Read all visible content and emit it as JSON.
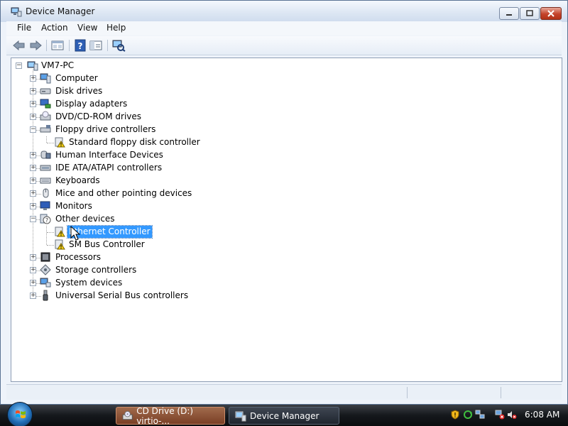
{
  "window": {
    "title": "Device Manager"
  },
  "menu": [
    "File",
    "Action",
    "View",
    "Help"
  ],
  "toolbar": {
    "buttons": [
      "back-arrow-icon",
      "forward-arrow-icon",
      "properties-icon",
      "help-icon",
      "show-hide-icon",
      "scan-hardware-icon"
    ]
  },
  "tree": {
    "root": "VM7-PC",
    "categories": [
      {
        "label": "Computer",
        "icon": "computer-icon",
        "expanded": false
      },
      {
        "label": "Disk drives",
        "icon": "disk-drive-icon",
        "expanded": false
      },
      {
        "label": "Display adapters",
        "icon": "display-adapter-icon",
        "expanded": false
      },
      {
        "label": "DVD/CD-ROM drives",
        "icon": "dvd-drive-icon",
        "expanded": false
      },
      {
        "label": "Floppy drive controllers",
        "icon": "floppy-controller-icon",
        "expanded": true,
        "children": [
          {
            "label": "Standard floppy disk controller",
            "warning": true
          }
        ]
      },
      {
        "label": "Human Interface Devices",
        "icon": "hid-icon",
        "expanded": false
      },
      {
        "label": "IDE ATA/ATAPI controllers",
        "icon": "ide-controller-icon",
        "expanded": false
      },
      {
        "label": "Keyboards",
        "icon": "keyboard-icon",
        "expanded": false
      },
      {
        "label": "Mice and other pointing devices",
        "icon": "mouse-icon",
        "expanded": false
      },
      {
        "label": "Monitors",
        "icon": "monitor-icon",
        "expanded": false
      },
      {
        "label": "Other devices",
        "icon": "unknown-device-icon",
        "expanded": true,
        "children": [
          {
            "label": "Ethernet Controller",
            "warning": true,
            "selected": true
          },
          {
            "label": "SM Bus Controller",
            "warning": true
          }
        ]
      },
      {
        "label": "Processors",
        "icon": "processor-icon",
        "expanded": false
      },
      {
        "label": "Storage controllers",
        "icon": "storage-controller-icon",
        "expanded": false
      },
      {
        "label": "System devices",
        "icon": "system-device-icon",
        "expanded": false
      },
      {
        "label": "Universal Serial Bus controllers",
        "icon": "usb-icon",
        "expanded": false
      }
    ]
  },
  "taskbar": {
    "tasks": [
      {
        "label": "CD Drive (D:) virtio-...",
        "icon": "cd-drive-icon"
      },
      {
        "label": "Device Manager",
        "icon": "device-manager-icon"
      }
    ],
    "clock": "6:08 AM"
  },
  "colors": {
    "selection": "#3399ff",
    "tree_bg": "#ffffff",
    "taskbar": "#15181c"
  }
}
